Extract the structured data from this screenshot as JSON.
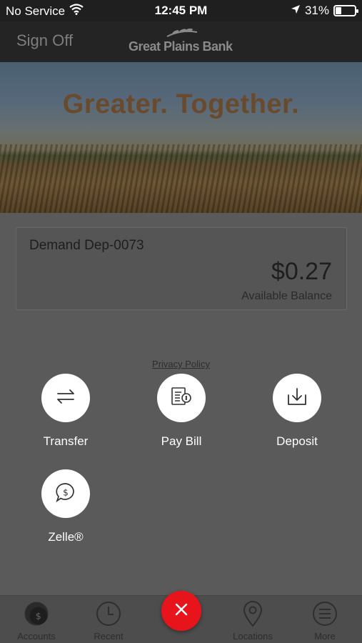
{
  "status_bar": {
    "carrier": "No Service",
    "time": "12:45 PM",
    "battery": "31%",
    "battery_level": 0.31
  },
  "header": {
    "sign_off": "Sign Off",
    "bank_name": "Great Plains Bank"
  },
  "hero": {
    "tagline": "Greater. Together."
  },
  "account": {
    "name": "Demand Dep-0073",
    "balance": "$0.27",
    "balance_label": "Available Balance"
  },
  "privacy_policy": "Privacy Policy",
  "actions": [
    {
      "label": "Transfer",
      "icon": "transfer-icon"
    },
    {
      "label": "Pay Bill",
      "icon": "bill-icon"
    },
    {
      "label": "Deposit",
      "icon": "deposit-icon"
    },
    {
      "label": "Zelle®",
      "icon": "zelle-icon"
    }
  ],
  "tabs": [
    {
      "label": "Accounts",
      "icon": "dollar-coin-icon"
    },
    {
      "label": "Recent",
      "icon": "clock-icon"
    },
    {
      "label": "Locations",
      "icon": "map-pin-icon"
    },
    {
      "label": "More",
      "icon": "menu-icon"
    }
  ],
  "fab_icon": "close-icon",
  "colors": {
    "fab": "#e8141c",
    "overlay": "#5a5a5a"
  }
}
